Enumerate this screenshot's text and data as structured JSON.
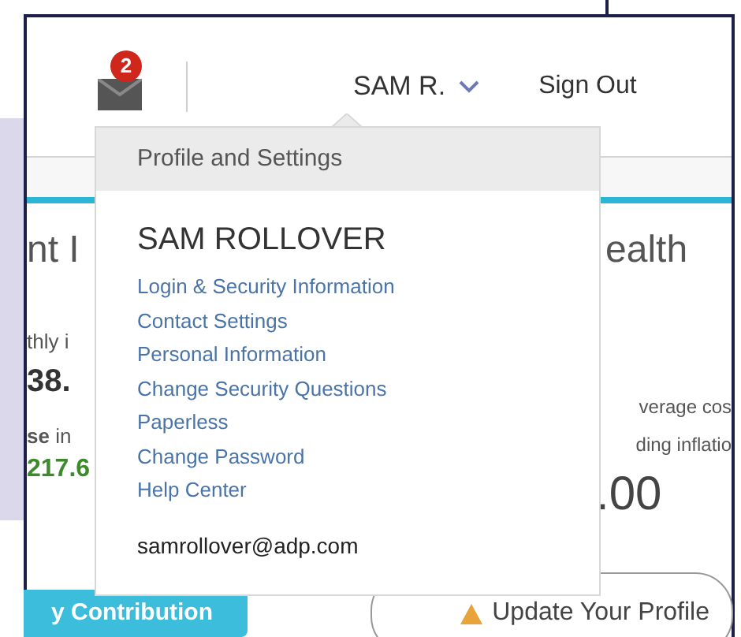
{
  "header": {
    "notification_count": "2",
    "user": "SAM R.",
    "sign_out": "Sign Out"
  },
  "menu": {
    "title": "Profile and Settings",
    "name": "SAM ROLLOVER",
    "links": [
      "Login & Security Information",
      "Contact Settings",
      "Personal Information",
      "Change Security Questions",
      "Paperless",
      "Change Password",
      "Help Center"
    ],
    "email": "samrollover@adp.com"
  },
  "left_card": {
    "title": "nt I",
    "label": "thly i",
    "value": "38.",
    "note": "**se** in",
    "amount": "217.6",
    "button": "y Contribution"
  },
  "right_card": {
    "title": "ealth",
    "line_1": "verage cos",
    "line_2": "ding inflatio",
    "value": ".00",
    "button": "Update Your Profile"
  }
}
